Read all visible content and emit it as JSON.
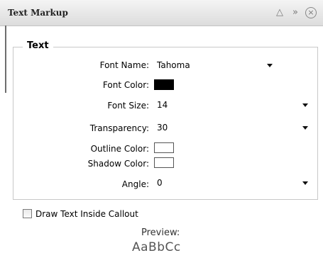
{
  "window": {
    "title": "Text Markup",
    "buttons": [
      "chevron-up-icon",
      "fast-forward-icon",
      "close-icon"
    ]
  },
  "group": {
    "legend": "Text"
  },
  "fields": {
    "font_name": {
      "label": "Font Name:",
      "value": "Tahoma"
    },
    "font_color": {
      "label": "Font Color:",
      "color": "#000000"
    },
    "font_size": {
      "label": "Font Size:",
      "value": "14"
    },
    "transparency": {
      "label": "Transparency:",
      "value": "30"
    },
    "outline": {
      "label": "Outline Color:",
      "color": "#ffffff"
    },
    "shadow": {
      "label": "Shadow Color:",
      "color": "#ffffff"
    },
    "angle": {
      "label": "Angle:",
      "value": "0"
    }
  },
  "draw_inside": {
    "label": "Draw Text Inside Callout",
    "checked": false
  },
  "preview": {
    "title": "Preview:",
    "sample": "AaBbCc"
  }
}
